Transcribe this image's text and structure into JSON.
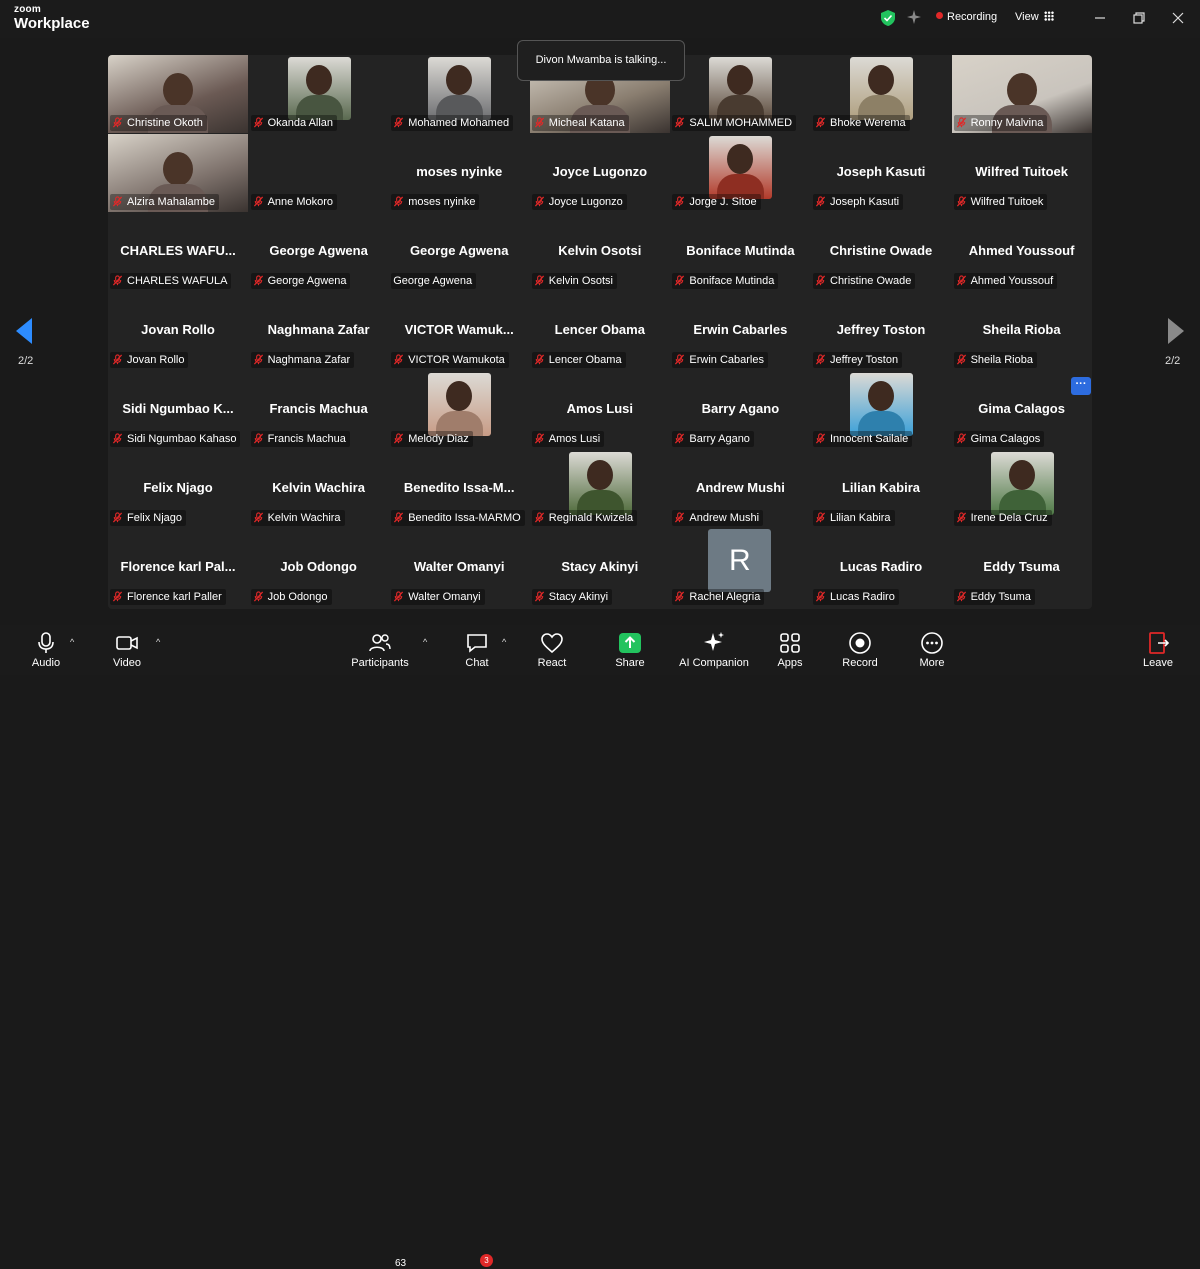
{
  "app": {
    "logo_small": "zoom",
    "logo_large": "Workplace",
    "recording_label": "Recording",
    "view_label": "View"
  },
  "colors": {
    "accent": "#2d6cdf",
    "recording": "#e02828",
    "share": "#22c35e",
    "shield": "#22c35e",
    "muted": "#e02828"
  },
  "talking_banner": "Divon Mwamba is talking...",
  "pagination": {
    "left": "2/2",
    "right": "2/2"
  },
  "participants": [
    {
      "name": "Christine Okoth",
      "label": "Christine Okoth",
      "video": true,
      "bg": "#6b5a54"
    },
    {
      "name": "Okanda Allan",
      "label": "Okanda Allan",
      "photo": true,
      "bg": "#5a6a50"
    },
    {
      "name": "Mohamed Mohamed",
      "label": "Mohamed Mohamed",
      "photo": true,
      "bg": "#6e6f72"
    },
    {
      "name": "Micheal Katana",
      "label": "Micheal Katana",
      "video": true,
      "bg": "#8a7e70"
    },
    {
      "name": "SALIM MOHAMMED",
      "label": "SALIM MOHAMMED",
      "photo": true,
      "bg": "#5b4a3c"
    },
    {
      "name": "Bhoke Werema",
      "label": "Bhoke Werema",
      "photo": true,
      "bg": "#b0a080"
    },
    {
      "name": "Ronny Malvina",
      "label": "Ronny Malvina",
      "video": true,
      "bg": "#c9c4bd"
    },
    {
      "name": "Alzira Mahalambe",
      "label": "Alzira Mahalambe",
      "video": true,
      "bg": "#7e726c"
    },
    {
      "name": "",
      "label": "Anne Mokoro"
    },
    {
      "name": "moses nyinke",
      "label": "moses nyinke"
    },
    {
      "name": "Joyce Lugonzo",
      "label": "Joyce Lugonzo"
    },
    {
      "name": "Jorge J. Sitoe",
      "label": "Jorge J. Sitoe",
      "photo": true,
      "bg": "#b23a2a"
    },
    {
      "name": "Joseph Kasuti",
      "label": "Joseph Kasuti"
    },
    {
      "name": "Wilfred Tuitoek",
      "label": "Wilfred Tuitoek"
    },
    {
      "name": "CHARLES  WAFU...",
      "label": "CHARLES WAFULA"
    },
    {
      "name": "George Agwena",
      "label": "George Agwena"
    },
    {
      "name": "George Agwena",
      "label": "George Agwena",
      "nomic": true
    },
    {
      "name": "Kelvin Osotsi",
      "label": "Kelvin Osotsi"
    },
    {
      "name": "Boniface Mutinda",
      "label": "Boniface Mutinda"
    },
    {
      "name": "Christine Owade",
      "label": "Christine Owade"
    },
    {
      "name": "Ahmed Youssouf",
      "label": "Ahmed Youssouf"
    },
    {
      "name": "Jovan Rollo",
      "label": "Jovan Rollo"
    },
    {
      "name": "Naghmana Zafar",
      "label": "Naghmana Zafar"
    },
    {
      "name": "VICTOR  Wamuk...",
      "label": "VICTOR Wamukota"
    },
    {
      "name": "Lencer Obama",
      "label": "Lencer Obama"
    },
    {
      "name": "Erwin Cabarles",
      "label": "Erwin Cabarles"
    },
    {
      "name": "Jeffrey Toston",
      "label": "Jeffrey Toston"
    },
    {
      "name": "Sheila Rioba",
      "label": "Sheila Rioba"
    },
    {
      "name": "Sidi  Ngumbao  K...",
      "label": "Sidi Ngumbao Kahaso"
    },
    {
      "name": "Francis Machua",
      "label": "Francis Machua"
    },
    {
      "name": "Melody Diaz",
      "label": "Melody Diaz",
      "photo": true,
      "bg": "#c89c86"
    },
    {
      "name": "Amos Lusi",
      "label": "Amos Lusi"
    },
    {
      "name": "Barry Agano",
      "label": "Barry Agano"
    },
    {
      "name": "Innocent Sailale",
      "label": "Innocent Sailale",
      "photo": true,
      "bg": "#3aa0d8"
    },
    {
      "name": "Gima Calagos",
      "label": "Gima Calagos"
    },
    {
      "name": "Felix Njago",
      "label": "Felix Njago"
    },
    {
      "name": "Kelvin Wachira",
      "label": "Kelvin Wachira"
    },
    {
      "name": "Benedito  Issa-M...",
      "label": "Benedito Issa-MARMO"
    },
    {
      "name": "Reginald Kwizela",
      "label": "Reginald Kwizela",
      "photo": true,
      "bg": "#4e6a3a"
    },
    {
      "name": "Andrew Mushi",
      "label": "Andrew Mushi"
    },
    {
      "name": "Lilian Kabira",
      "label": "Lilian Kabira"
    },
    {
      "name": "Irene Dela Cruz",
      "label": "Irene Dela Cruz",
      "photo": true,
      "bg": "#4f7a46"
    },
    {
      "name": "Florence  karl  Pal...",
      "label": "Florence karl Paller"
    },
    {
      "name": "Job Odongo",
      "label": "Job Odongo"
    },
    {
      "name": "Walter Omanyi",
      "label": "Walter Omanyi"
    },
    {
      "name": "Stacy Akinyi",
      "label": "Stacy Akinyi"
    },
    {
      "name": "Rachel Alegria",
      "label": "Rachel Alegria",
      "avatar": "R"
    },
    {
      "name": "Lucas Radiro",
      "label": "Lucas Radiro"
    },
    {
      "name": "Eddy Tsuma",
      "label": "Eddy Tsuma"
    }
  ],
  "toolbar": {
    "audio": "Audio",
    "video": "Video",
    "participants": "Participants",
    "participants_count": "63",
    "chat": "Chat",
    "chat_badge": "3",
    "react": "React",
    "share": "Share",
    "ai_companion": "AI Companion",
    "apps": "Apps",
    "record": "Record",
    "more": "More",
    "leave": "Leave"
  }
}
